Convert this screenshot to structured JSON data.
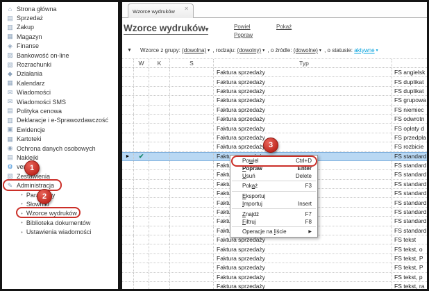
{
  "sidebar": {
    "items": [
      {
        "label": "Strona główna",
        "icon": "home-icon",
        "glyph": "⌂"
      },
      {
        "label": "Sprzedaż",
        "icon": "sales-icon",
        "glyph": "▤"
      },
      {
        "label": "Zakup",
        "icon": "purchase-icon",
        "glyph": "▥"
      },
      {
        "label": "Magazyn",
        "icon": "warehouse-icon",
        "glyph": "▦"
      },
      {
        "label": "Finanse",
        "icon": "finance-icon",
        "glyph": "◈"
      },
      {
        "label": "Bankowość on-line",
        "icon": "online-banking-icon",
        "glyph": "▨"
      },
      {
        "label": "Rozrachunki",
        "icon": "settlements-icon",
        "glyph": "▧"
      },
      {
        "label": "Działania",
        "icon": "actions-icon",
        "glyph": "◆"
      },
      {
        "label": "Kalendarz",
        "icon": "calendar-icon",
        "glyph": "▦"
      },
      {
        "label": "Wiadomości",
        "icon": "messages-icon",
        "glyph": "✉"
      },
      {
        "label": "Wiadomości SMS",
        "icon": "sms-icon",
        "glyph": "✉"
      },
      {
        "label": "Polityka cenowa",
        "icon": "pricing-icon",
        "glyph": "▤"
      },
      {
        "label": "Deklaracje i e-Sprawozdawczość",
        "icon": "declarations-icon",
        "glyph": "▥"
      },
      {
        "label": "Ewidencje",
        "icon": "records-icon",
        "glyph": "▣"
      },
      {
        "label": "Kartoteki",
        "icon": "catalogs-icon",
        "glyph": "▦"
      },
      {
        "label": "Ochrona danych osobowych",
        "icon": "data-protection-icon",
        "glyph": "◉"
      },
      {
        "label": "Naklejki",
        "icon": "labels-icon",
        "glyph": "▤"
      },
      {
        "label": "vendero",
        "icon": "vendero-gear-icon",
        "glyph": "⚙",
        "color": "#2e86d4"
      },
      {
        "label": "Zestawienia",
        "icon": "reports-icon",
        "glyph": "▧"
      },
      {
        "label": "Administracja",
        "icon": "administration-icon",
        "glyph": "✎"
      }
    ],
    "admin_children": [
      {
        "label": "Parametry"
      },
      {
        "label": "Słowniki"
      },
      {
        "label": "Wzorce wydruków"
      },
      {
        "label": "Biblioteka dokumentów"
      },
      {
        "label": "Ustawienia wiadomości"
      }
    ]
  },
  "tab": {
    "label": "Wzorce wydruków",
    "close_glyph": "✕"
  },
  "header": {
    "title": "Wzorce wydruków",
    "dropdown_arrow": "▾",
    "links": {
      "powiel": "Powiel",
      "popraw": "Popraw",
      "pokaz": "Pokaż"
    }
  },
  "filter": {
    "funnel_glyph": "▼",
    "group_label": "Wzorce z grupy:",
    "group_value": "(dowolna)",
    "type_label": ", rodzaju:",
    "type_value": "(dowolny)",
    "source_label": ", o źródle:",
    "source_value": "(dowolne)",
    "status_label": ", o statusie:",
    "status_value": "aktywne",
    "dropdown_arrow": "▼",
    "status_color": "#00a0dc"
  },
  "table": {
    "columns": [
      "",
      "W",
      "K",
      "S",
      "Typ",
      ""
    ],
    "selected_index": 9,
    "selected_marker": "►",
    "selected_check": "✔",
    "rows": [
      {
        "typ": "Faktura sprzedaży",
        "name": "FS angielsk"
      },
      {
        "typ": "Faktura sprzedaży",
        "name": "FS duplikat"
      },
      {
        "typ": "Faktura sprzedaży",
        "name": "FS duplikat"
      },
      {
        "typ": "Faktura sprzedaży",
        "name": "FS grupowa"
      },
      {
        "typ": "Faktura sprzedaży",
        "name": "FS niemiec"
      },
      {
        "typ": "Faktura sprzedaży",
        "name": "FS odwrotn"
      },
      {
        "typ": "Faktura sprzedaży",
        "name": "FS opłaty d"
      },
      {
        "typ": "Faktura sprzedaży",
        "name": "FS przedpła"
      },
      {
        "typ": "Faktura sprzedaży",
        "name": "FS rozbicie"
      },
      {
        "typ": "Faktura sprzedaży",
        "name": "FS standard"
      },
      {
        "typ": "Faktura sprzedaży",
        "name": "FS standard"
      },
      {
        "typ": "Faktura sprzedaży",
        "name": "FS standard"
      },
      {
        "typ": "Faktura sprzedaży",
        "name": "FS standard"
      },
      {
        "typ": "Faktura sprzedaży",
        "name": "FS standard"
      },
      {
        "typ": "Faktura sprzedaży",
        "name": "FS standard"
      },
      {
        "typ": "Faktura sprzedaży",
        "name": "FS standard"
      },
      {
        "typ": "Faktura sprzedaży",
        "name": "FS standard"
      },
      {
        "typ": "Faktura sprzedaży",
        "name": "FS standard"
      },
      {
        "typ": "Faktura sprzedaży",
        "name": "FS tekst"
      },
      {
        "typ": "Faktura sprzedaży",
        "name": "FS tekst, o"
      },
      {
        "typ": "Faktura sprzedaży",
        "name": "FS tekst, P"
      },
      {
        "typ": "Faktura sprzedaży",
        "name": "FS tekst, P"
      },
      {
        "typ": "Faktura sprzedaży",
        "name": "FS tekst, p"
      },
      {
        "typ": "Faktura sprzedaży",
        "name": "FS tekst, ra"
      }
    ]
  },
  "context_menu": {
    "items": [
      {
        "pre": "Po",
        "u": "w",
        "post": "iel",
        "shortcut": "Ctrl+D",
        "bold": false,
        "sep_after": false,
        "name": "menu-item-powiel"
      },
      {
        "pre": "",
        "u": "P",
        "post": "opraw",
        "shortcut": "Enter",
        "bold": true,
        "sep_after": false,
        "name": "menu-item-popraw"
      },
      {
        "pre": "",
        "u": "U",
        "post": "suń",
        "shortcut": "Delete",
        "bold": false,
        "sep_after": true,
        "name": "menu-item-usun"
      },
      {
        "pre": "Pok",
        "u": "a",
        "post": "ż",
        "shortcut": "F3",
        "bold": false,
        "sep_after": true,
        "name": "menu-item-pokaz"
      },
      {
        "pre": "",
        "u": "E",
        "post": "ksportuj",
        "shortcut": "",
        "bold": false,
        "sep_after": false,
        "name": "menu-item-eksportuj"
      },
      {
        "pre": "",
        "u": "I",
        "post": "mportuj",
        "shortcut": "Insert",
        "bold": false,
        "sep_after": true,
        "name": "menu-item-importuj"
      },
      {
        "pre": "",
        "u": "Z",
        "post": "najdź",
        "shortcut": "F7",
        "bold": false,
        "sep_after": false,
        "name": "menu-item-znajdz"
      },
      {
        "pre": "",
        "u": "F",
        "post": "iltruj",
        "shortcut": "F8",
        "bold": false,
        "sep_after": true,
        "name": "menu-item-filtruj"
      },
      {
        "pre": "Operacje na ",
        "u": "l",
        "post": "iście",
        "shortcut": "▶",
        "bold": false,
        "sep_after": false,
        "submenu": true,
        "name": "menu-item-operacje-na-liscie"
      }
    ]
  },
  "annotations": {
    "badges": [
      "1",
      "2",
      "3"
    ],
    "color": "#cb2f28"
  }
}
